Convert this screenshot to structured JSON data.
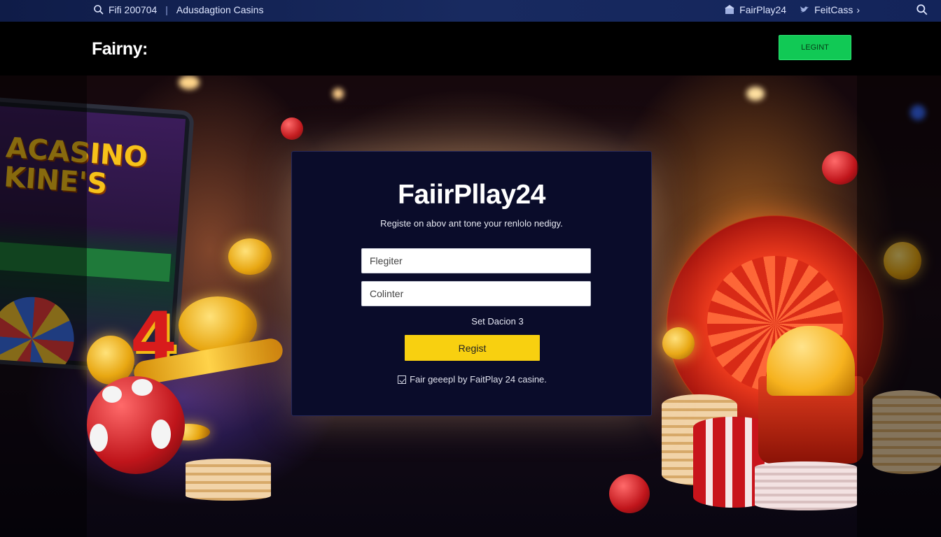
{
  "topbar": {
    "left_text": "Fifi 200704",
    "separator": "|",
    "section": "Adusdagtion Casins",
    "brand_link": "FairPlay24",
    "social_link": "FeitCass",
    "social_arrow": "›"
  },
  "header": {
    "logo": "Fairny:",
    "login_label": "LEGINT"
  },
  "register_card": {
    "title": "FaiirPllay24",
    "subtitle": "Registe on abov ant tone your renlolo nedigy.",
    "field1_placeholder": "Flegiter",
    "field2_placeholder": "Colinter",
    "set_link": "Set Dacion 3",
    "submit_label": "Regist",
    "footnote": "Fair geeepl by FaitPlay 24 casine."
  },
  "hero_art": {
    "tablet_title_line1": "ACASINO",
    "tablet_title_line2": "KINE'S",
    "big_number": "4"
  },
  "colors": {
    "topbar_bg": "#13245a",
    "login_button": "#11c955",
    "register_button": "#f8d010",
    "card_bg": "#0a0c2a"
  },
  "icons": {
    "topbar_search": "search-icon",
    "brand_link": "building-icon",
    "social_link": "twitter-bird-icon",
    "topbar_search_right": "search-icon",
    "footnote": "checkbox-icon"
  }
}
